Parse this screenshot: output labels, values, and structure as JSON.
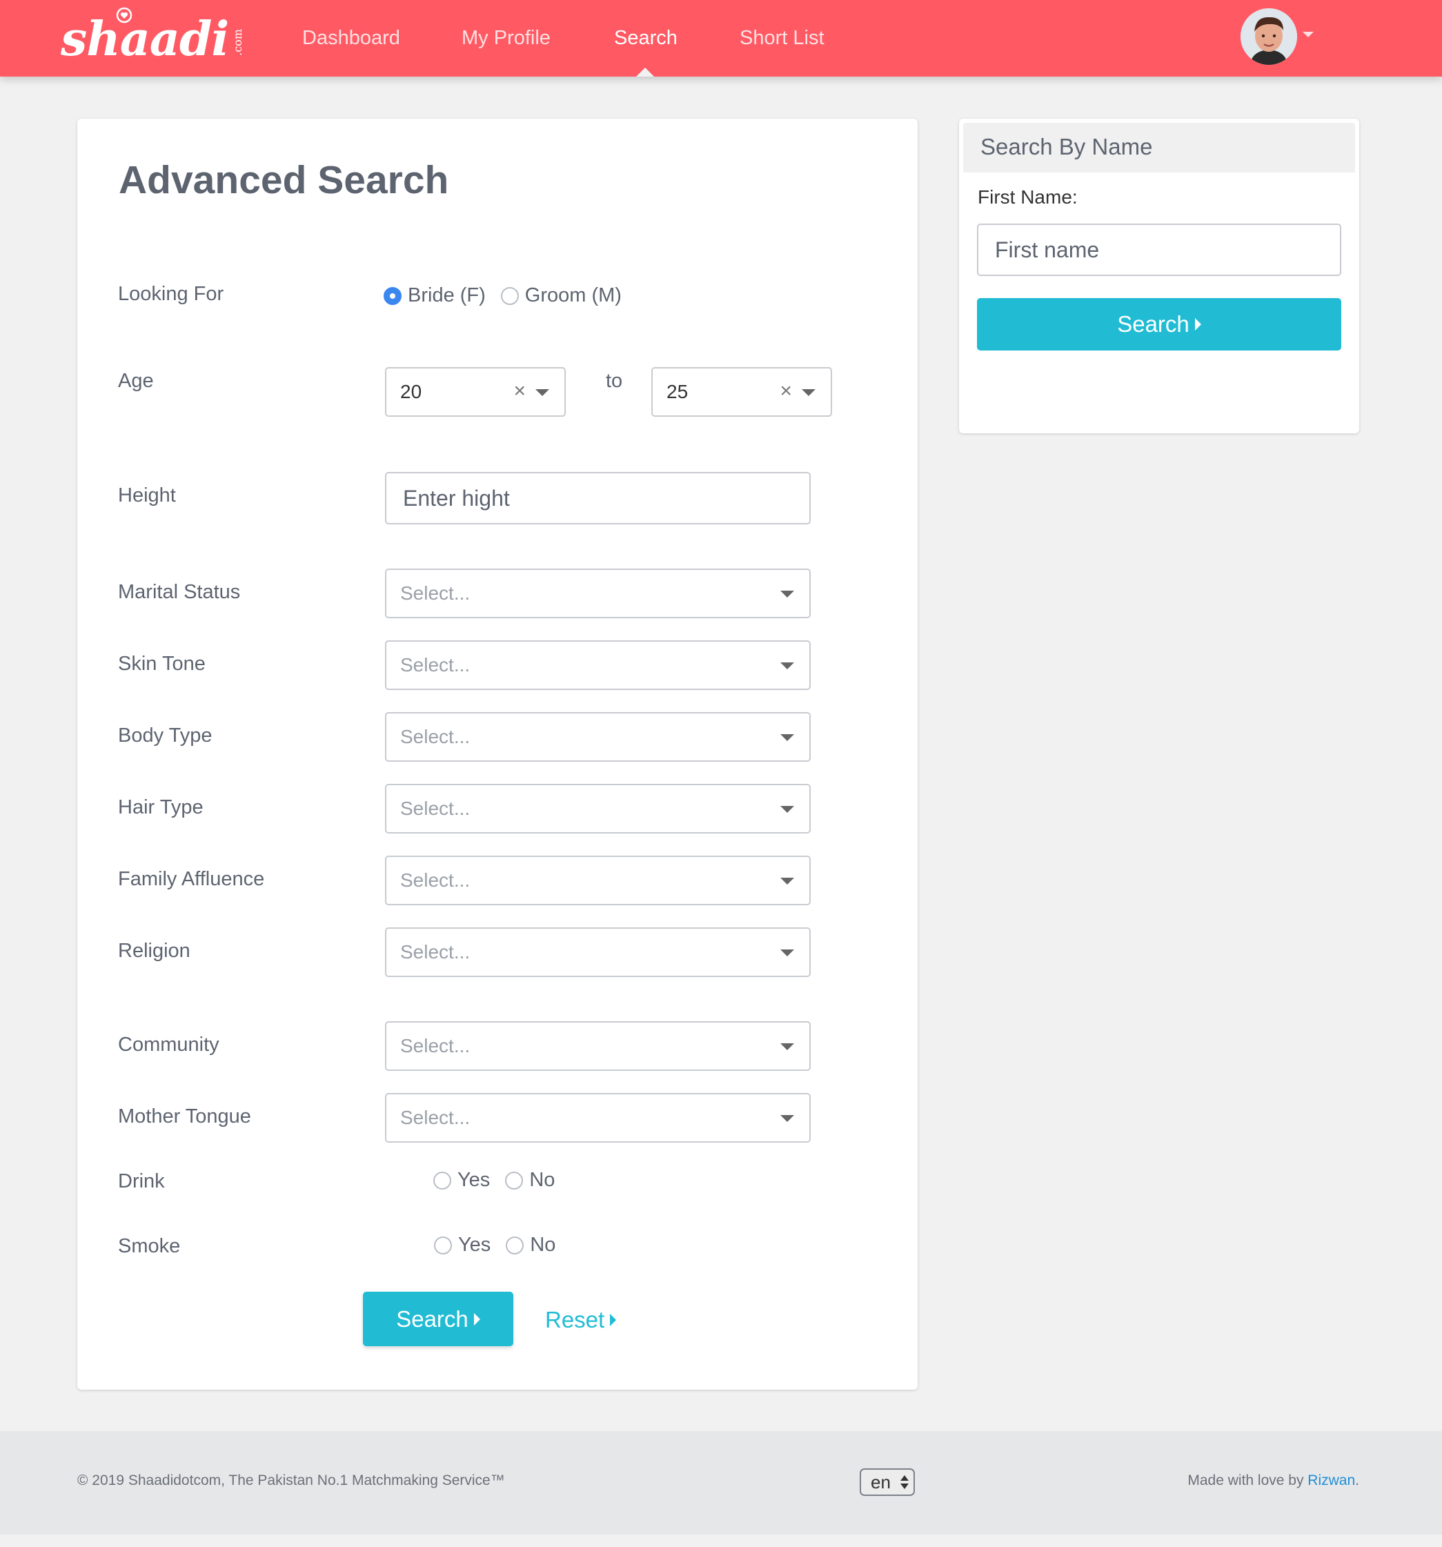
{
  "brand": {
    "name": "shaadi",
    "suffix": ".com",
    "color": "#ff5a64"
  },
  "nav": {
    "items": [
      {
        "label": "Dashboard"
      },
      {
        "label": "My Profile"
      },
      {
        "label": "Search",
        "active": true
      },
      {
        "label": "Short List"
      }
    ]
  },
  "advanced_search": {
    "title": "Advanced Search",
    "looking_for": {
      "label": "Looking For",
      "options": [
        "Bride (F)",
        "Groom (M)"
      ],
      "selected": "Bride (F)"
    },
    "age": {
      "label": "Age",
      "from": "20",
      "to_label": "to",
      "to": "25"
    },
    "height": {
      "label": "Height",
      "placeholder": "Enter hight"
    },
    "selects": [
      {
        "label": "Marital Status",
        "placeholder": "Select..."
      },
      {
        "label": "Skin Tone",
        "placeholder": "Select..."
      },
      {
        "label": "Body Type",
        "placeholder": "Select..."
      },
      {
        "label": "Hair Type",
        "placeholder": "Select..."
      },
      {
        "label": "Family Affluence",
        "placeholder": "Select..."
      },
      {
        "label": "Religion",
        "placeholder": "Select..."
      },
      {
        "label": "Community",
        "placeholder": "Select..."
      },
      {
        "label": "Mother Tongue",
        "placeholder": "Select..."
      }
    ],
    "drink": {
      "label": "Drink",
      "options": [
        "Yes",
        "No"
      ]
    },
    "smoke": {
      "label": "Smoke",
      "options": [
        "Yes",
        "No"
      ]
    },
    "search_label": "Search",
    "reset_label": "Reset"
  },
  "search_by_name": {
    "title": "Search By Name",
    "first_name_label": "First Name:",
    "first_name_placeholder": "First name",
    "search_label": "Search"
  },
  "footer": {
    "copyright": "© 2019 Shaadidotcom, The Pakistan No.1 Matchmaking Service™",
    "language": "en",
    "made_with": "Made with love by ",
    "author": "Rizwan",
    "made_with_end": "."
  },
  "colors": {
    "accent": "#21bcd4",
    "header": "#ff5a64",
    "radio_checked": "#3b87f0"
  }
}
